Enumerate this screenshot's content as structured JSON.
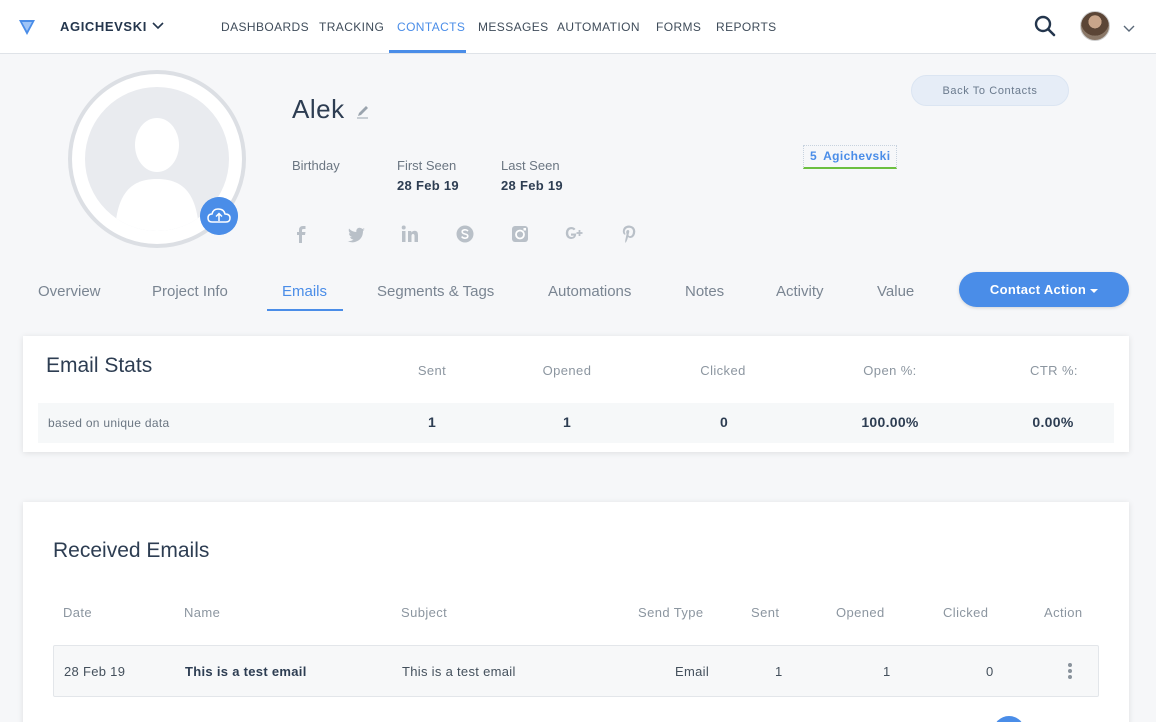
{
  "nav": {
    "account": "AGICHEVSKI",
    "items": [
      {
        "label": "DASHBOARDS"
      },
      {
        "label": "TRACKING"
      },
      {
        "label": "CONTACTS"
      },
      {
        "label": "MESSAGES"
      },
      {
        "label": "AUTOMATION"
      },
      {
        "label": "FORMS"
      },
      {
        "label": "REPORTS"
      }
    ],
    "active_item": "CONTACTS"
  },
  "profile": {
    "name": "Alek",
    "birthday_label": "Birthday",
    "first_seen_label": "First Seen",
    "first_seen": "28 Feb 19",
    "last_seen_label": "Last Seen",
    "last_seen": "28 Feb 19",
    "social": [
      "facebook-icon",
      "twitter-icon",
      "linkedin-icon",
      "skype-icon",
      "instagram-icon",
      "google-plus-icon",
      "pinterest-icon"
    ],
    "back_button": "Back To Contacts",
    "segment_count": "5",
    "segment_name": "Agichevski"
  },
  "tabs": {
    "items": [
      "Overview",
      "Project Info",
      "Emails",
      "Segments & Tags",
      "Automations",
      "Notes",
      "Activity",
      "Value"
    ],
    "active": "Emails",
    "contact_action": "Contact Action"
  },
  "email_stats": {
    "title": "Email Stats",
    "note": "based on unique data",
    "headers": [
      "Sent",
      "Opened",
      "Clicked",
      "Open %:",
      "CTR %:"
    ],
    "values": [
      "1",
      "1",
      "0",
      "100.00%",
      "0.00%"
    ]
  },
  "received": {
    "title": "Received Emails",
    "columns": [
      "Date",
      "Name",
      "Subject",
      "Send Type",
      "Sent",
      "Opened",
      "Clicked",
      "Action"
    ],
    "rows": [
      {
        "date": "28 Feb 19",
        "name": "This is a test email",
        "subject": "This is a test email",
        "send_type": "Email",
        "sent": "1",
        "opened": "1",
        "clicked": "0"
      }
    ]
  },
  "colors": {
    "accent": "#4a8de8",
    "segment_underline": "#6cbf3f",
    "page_bg": "#f6f7f9"
  }
}
